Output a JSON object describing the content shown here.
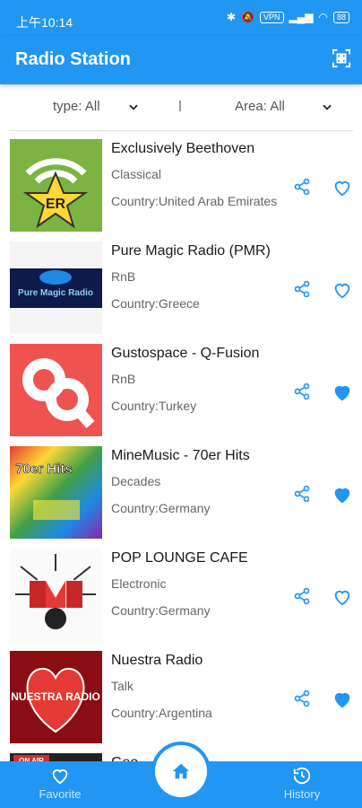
{
  "status": {
    "time": "上午10:14",
    "vpn": "VPN",
    "network": "4G",
    "battery": "88"
  },
  "appbar": {
    "title": "Radio Station",
    "scan_icon": "qr-scan-icon"
  },
  "filters": {
    "type": "type: All",
    "area": "Area: All"
  },
  "stations": [
    {
      "name": "Exclusively Beethoven",
      "genre": "Classical",
      "country": "Country:United Arab Emirates",
      "favorite": false,
      "logo_text": "ER"
    },
    {
      "name": "Pure Magic Radio (PMR)",
      "genre": "RnB",
      "country": "Country:Greece",
      "favorite": false,
      "logo_text": "Pure Magic Radio"
    },
    {
      "name": "Gustospace - Q-Fusion",
      "genre": "RnB",
      "country": "Country:Turkey",
      "favorite": true,
      "logo_text": ""
    },
    {
      "name": "MineMusic - 70er Hits",
      "genre": "Decades",
      "country": "Country:Germany",
      "favorite": true,
      "logo_text": "70er Hits"
    },
    {
      "name": "POP LOUNGE CAFE",
      "genre": "Electronic",
      "country": "Country:Germany",
      "favorite": false,
      "logo_text": ""
    },
    {
      "name": "Nuestra Radio",
      "genre": "Talk",
      "country": "Country:Argentina",
      "favorite": true,
      "logo_text": "NUESTRA RADIO"
    },
    {
      "name": "Geo",
      "genre": "",
      "country": "",
      "favorite": false,
      "logo_text": "ON AIR"
    }
  ],
  "bottom_nav": {
    "favorite": "Favorite",
    "history": "History",
    "home_icon": "home-icon"
  },
  "colors": {
    "primary": "#2196f3",
    "heart_filled": "#2196f3"
  }
}
